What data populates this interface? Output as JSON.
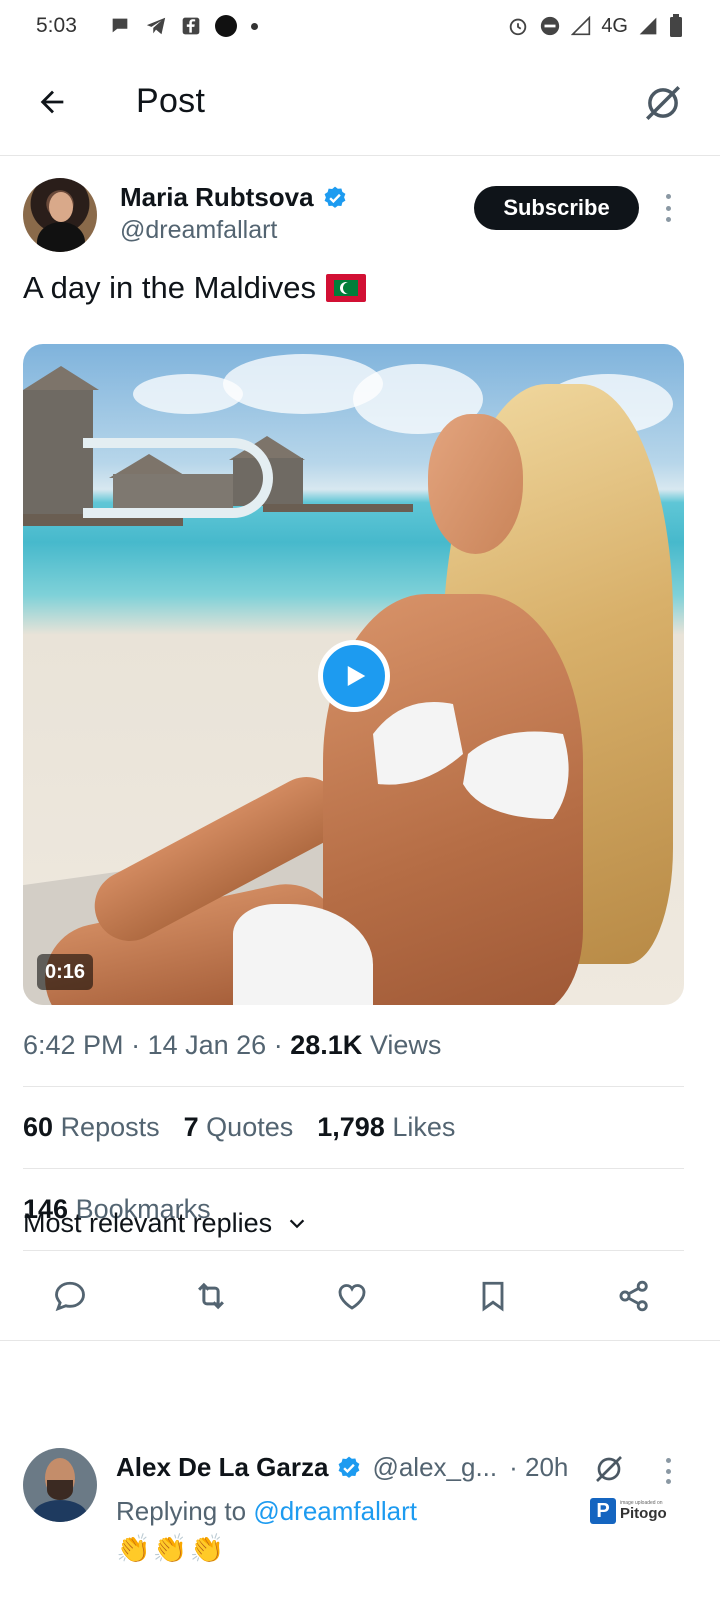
{
  "status_bar": {
    "time": "5:03",
    "network": "4G"
  },
  "header": {
    "title": "Post"
  },
  "post": {
    "author": {
      "name": "Maria Rubtsova",
      "handle": "@dreamfallart",
      "verified": true
    },
    "subscribe_label": "Subscribe",
    "text": "A day in the Maldives",
    "flag_icon": "maldives-flag",
    "video": {
      "duration": "0:16"
    },
    "time": "6:42 PM",
    "date": "14 Jan 26",
    "views_count": "28.1K",
    "views_label": "Views",
    "separator": "·",
    "stats": {
      "reposts_count": "60",
      "reposts_label": "Reposts",
      "quotes_count": "7",
      "quotes_label": "Quotes",
      "likes_count": "1,798",
      "likes_label": "Likes",
      "bookmarks_count": "146",
      "bookmarks_label": "Bookmarks"
    }
  },
  "actions": [
    "reply-icon",
    "repost-icon",
    "like-icon",
    "bookmark-icon",
    "share-icon"
  ],
  "replies": {
    "header": "Most relevant replies",
    "items": [
      {
        "name": "Alex De La Garza",
        "handle": "@alex_g...",
        "time": "· 20h",
        "replying_prefix": "Replying to",
        "replying_to": "@dreamfallart",
        "body": "👏👏👏"
      }
    ]
  },
  "watermark": {
    "small": "image uploaded on",
    "brand": "Pitogo",
    "logo_letter": "P"
  },
  "colors": {
    "accent": "#1d9bf0",
    "text": "#0f1419",
    "muted": "#536471"
  }
}
